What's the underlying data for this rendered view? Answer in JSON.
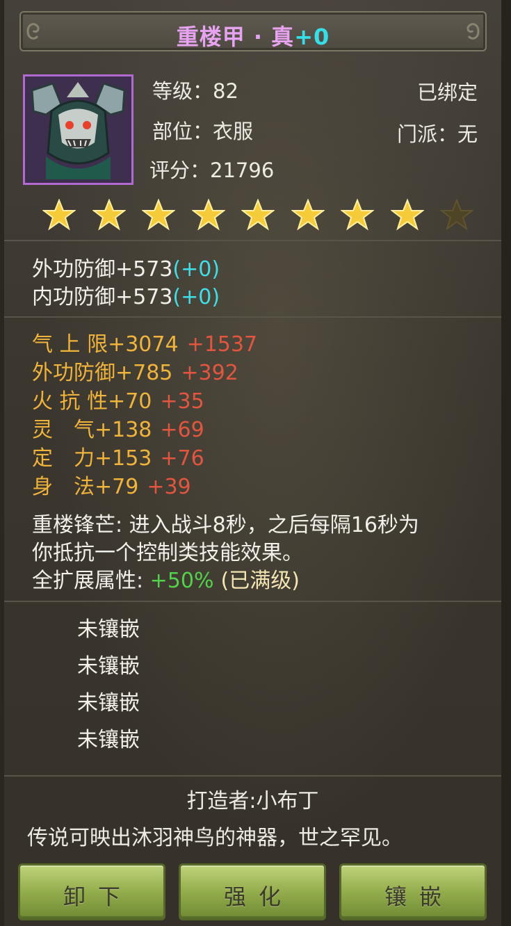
{
  "header": {
    "item_name": "重楼甲 · 真",
    "plus": "+0"
  },
  "info": {
    "level_label": "等级：",
    "level": "82",
    "slot_label": "部位：",
    "slot": "衣服",
    "score_label": "评分：",
    "score": "21796",
    "bound": "已绑定",
    "sect_label": "门派：",
    "sect": "无"
  },
  "stars": {
    "filled": 8,
    "total": 9
  },
  "base_attrs": [
    {
      "text": "外功防御+573",
      "bonus": "(+0)"
    },
    {
      "text": "内功防御+573",
      "bonus": "(+0)"
    }
  ],
  "ext_attrs": [
    {
      "text": "气 上 限+3074",
      "bonus": "+1537"
    },
    {
      "text": "外功防御+785",
      "bonus": "+392"
    },
    {
      "text": "火 抗 性+70",
      "bonus": "+35"
    },
    {
      "text": "灵　气+138",
      "bonus": "+69"
    },
    {
      "text": "定　力+153",
      "bonus": "+76"
    },
    {
      "text": "身　法+79",
      "bonus": "+39"
    }
  ],
  "skill": {
    "line1": "重楼锋芒: 进入战斗8秒，之后每隔16秒为",
    "line2": "你抵抗一个控制类技能效果。"
  },
  "expand": {
    "label": "全扩展属性: ",
    "value": "+50%",
    "note": "(已满级)"
  },
  "sockets": [
    "未镶嵌",
    "未镶嵌",
    "未镶嵌",
    "未镶嵌"
  ],
  "maker": "打造者:小布丁",
  "lore": "传说可映出沐羽神鸟的神器，世之罕见。",
  "buttons": {
    "unequip": "卸下",
    "enhance": "强化",
    "inlay": "镶嵌"
  },
  "colors": {
    "title_name": "#e6a3f0",
    "title_plus": "#34e0e6",
    "ext_attr": "#f0b43a",
    "ext_bonus": "#e4553f",
    "expand_value": "#52d24a",
    "button": "#93ad4c"
  }
}
